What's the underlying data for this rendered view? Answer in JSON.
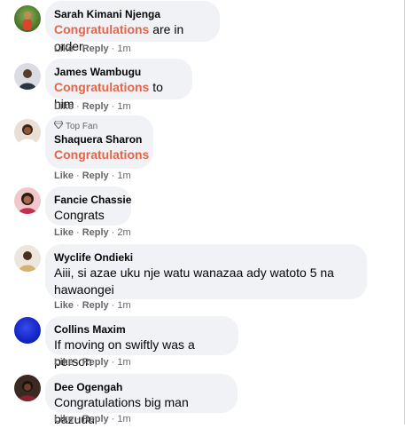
{
  "comments": [
    {
      "author": "Sarah Kimani Njenga",
      "mention": "Congratulations",
      "text": " are in order,",
      "like": "Like",
      "reply": "Reply",
      "time": "1m",
      "avatar": "avatar-outdoor"
    },
    {
      "author": "James Wambugu",
      "mention": "Congratulations",
      "text": " to him",
      "like": "Like",
      "reply": "Reply",
      "time": "1m",
      "avatar": "avatar-person"
    },
    {
      "author": "Shaquera Sharon",
      "badge": "Top Fan",
      "mention": "Congratulations",
      "text": "",
      "like": "Like",
      "reply": "Reply",
      "time": "1m",
      "avatar": "avatar-person"
    },
    {
      "author": "Fancie Chassie",
      "mention": "",
      "text": "Congrats",
      "like": "Like",
      "reply": "Reply",
      "time": "2m",
      "avatar": "avatar-person-pink"
    },
    {
      "author": "Wyclife Ondieki",
      "mention": "",
      "text": "Aiii, si azae uku nje watu wanazaa ady watoto 5 na hawaongei",
      "like": "Like",
      "reply": "Reply",
      "time": "1m",
      "avatar": "avatar-person"
    },
    {
      "author": "Collins Maxim",
      "mention": "",
      "text": "If moving on swiftly was a person",
      "like": "Like",
      "reply": "Reply",
      "time": "1m",
      "avatar": "avatar-blue"
    },
    {
      "author": "Dee Ogengah",
      "mention": "",
      "text": "Congratulations big man bazuuu",
      "like": "Like",
      "reply": "Reply",
      "time": "1m",
      "avatar": "avatar-person-dark"
    }
  ],
  "colors": {
    "mention": "#e4654a",
    "bubble": "#f0f2f5",
    "meta": "#65676b"
  }
}
